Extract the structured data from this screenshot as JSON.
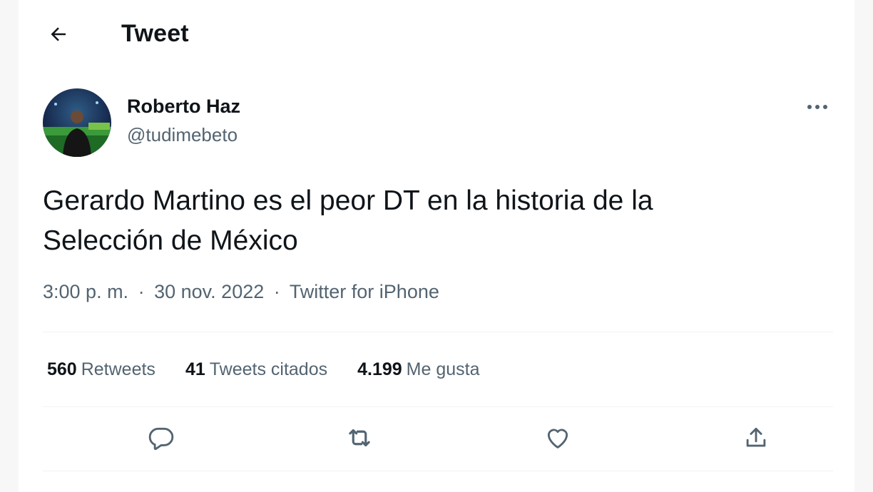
{
  "header": {
    "title": "Tweet",
    "back_icon": "arrow-left-icon"
  },
  "author": {
    "name": "Roberto Haz",
    "handle": "@tudimebeto"
  },
  "tweet": {
    "text_line1": "Gerardo Martino es el peor DT en la historia de la",
    "text_line2": "Selección de México"
  },
  "meta": {
    "time": "3:00 p. m.",
    "separator": "·",
    "date": "30 nov. 2022",
    "source": "Twitter for iPhone"
  },
  "stats": {
    "retweets_count": "560",
    "retweets_label": "Retweets",
    "quotes_count": "41",
    "quotes_label": "Tweets citados",
    "likes_count": "4.199",
    "likes_label": "Me gusta"
  },
  "actions": {
    "reply_icon": "reply-icon",
    "retweet_icon": "retweet-icon",
    "like_icon": "heart-icon",
    "share_icon": "share-icon"
  },
  "colors": {
    "text_primary": "#0f1419",
    "text_secondary": "#536471",
    "divider": "#eff3f4"
  }
}
